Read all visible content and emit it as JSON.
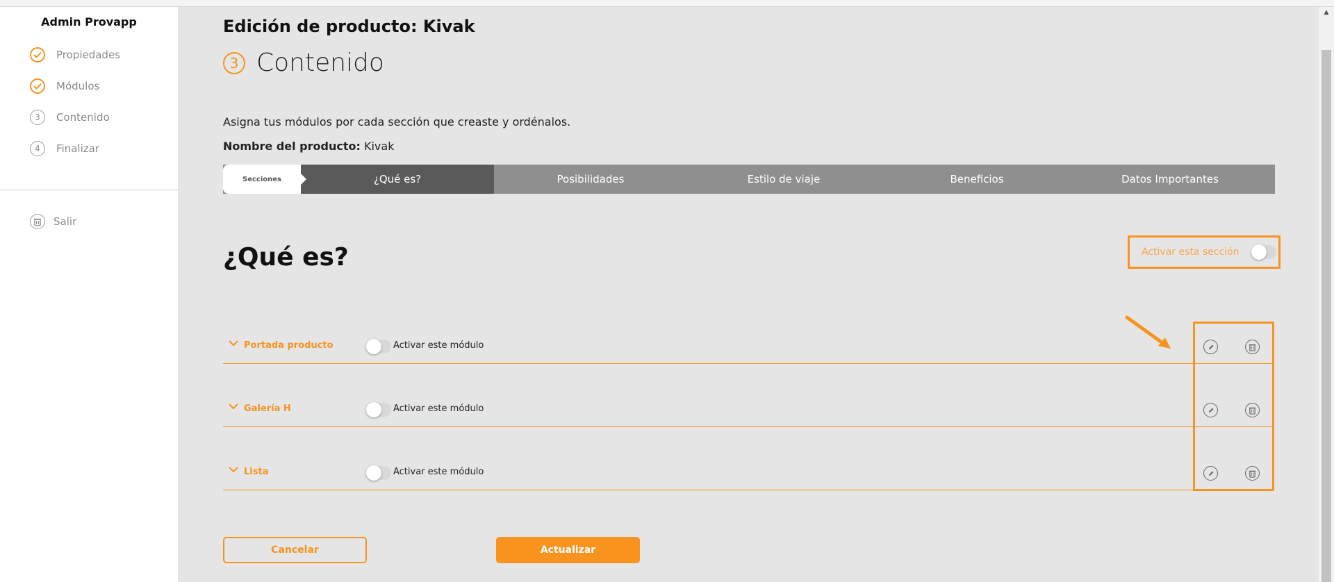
{
  "app": {
    "title": "Admin Provapp"
  },
  "sidebar": {
    "steps": [
      {
        "label": "Propiedades",
        "status": "done",
        "icon": "check-circle-icon"
      },
      {
        "label": "Módulos",
        "status": "done",
        "icon": "check-circle-icon"
      },
      {
        "label": "Contenido",
        "status": "current",
        "number": "3"
      },
      {
        "label": "Finalizar",
        "status": "pending",
        "number": "4"
      }
    ],
    "logout_label": "Salir"
  },
  "header": {
    "title": "Edición de producto: Kivak",
    "step_number": "3",
    "step_title": "Contenido"
  },
  "instructions": "Asigna tus módulos por cada sección que creaste y ordénalos.",
  "product": {
    "label": "Nombre del producto:",
    "value": "Kivak"
  },
  "tabs": {
    "sections_label": "Secciones",
    "items": [
      {
        "label": "¿Qué es?",
        "active": true
      },
      {
        "label": "Posibilidades",
        "active": false
      },
      {
        "label": "Estilo de viaje",
        "active": false
      },
      {
        "label": "Beneficios",
        "active": false
      },
      {
        "label": "Datos Importantes",
        "active": false
      }
    ]
  },
  "section": {
    "title": "¿Qué es?",
    "activate_label": "Activar esta sección",
    "activate_on": false
  },
  "modules": [
    {
      "name": "Portada producto",
      "toggle_label": "Activar este módulo",
      "on": false
    },
    {
      "name": "Galería H",
      "toggle_label": "Activar este módulo",
      "on": false
    },
    {
      "name": "Lista",
      "toggle_label": "Activar este módulo",
      "on": false
    }
  ],
  "buttons": {
    "cancel": "Cancelar",
    "update": "Actualizar"
  },
  "colors": {
    "accent": "#f7931e",
    "tab_bg": "#8f8f8f",
    "tab_active": "#5a5a5a",
    "page_bg": "#e5e5e5"
  }
}
